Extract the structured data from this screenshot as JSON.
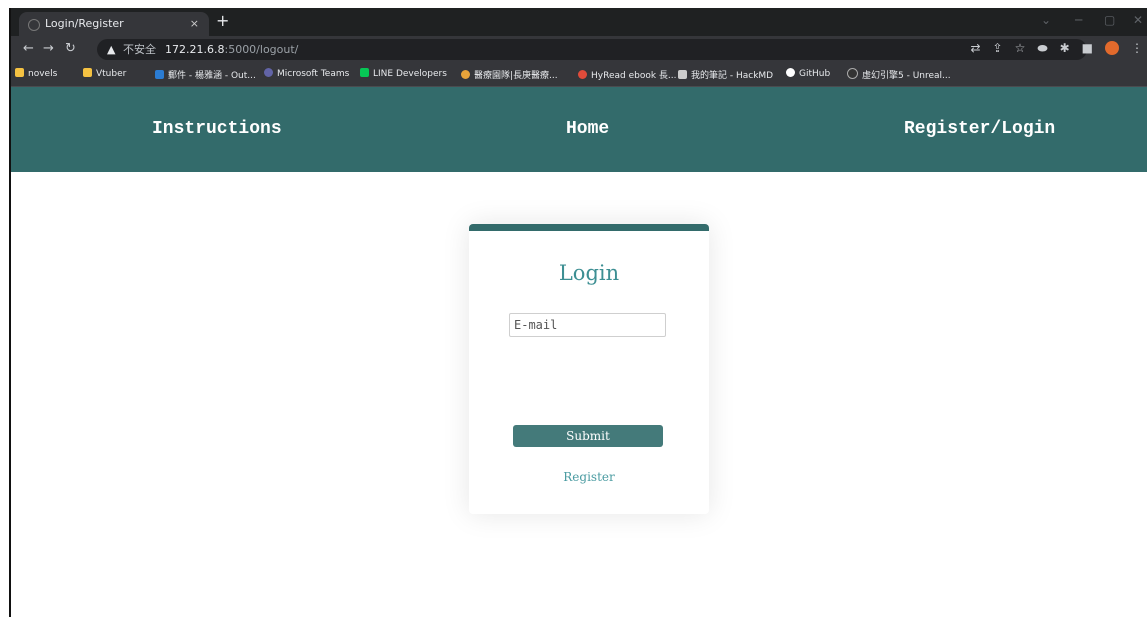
{
  "browser": {
    "tab_title": "Login/Register",
    "tab_close": "×",
    "new_tab": "+",
    "address": {
      "warning": "▲",
      "security_label": "不安全",
      "host": "172.21.6.8",
      "path": ":5000/logout/"
    },
    "bookmarks": [
      {
        "label": "novels",
        "icon_color": "#f5c242"
      },
      {
        "label": "Vtuber",
        "icon_color": "#f5c242"
      },
      {
        "label": "郵件 - 楊雅涵 - Out...",
        "icon_color": "#2b7cd3"
      },
      {
        "label": "Microsoft Teams",
        "icon_color": "#6264a7"
      },
      {
        "label": "LINE Developers",
        "icon_color": "#06c755"
      },
      {
        "label": "醫療園隊|長庚醫療...",
        "icon_color": "#e8a33a"
      },
      {
        "label": "HyRead ebook 長...",
        "icon_color": "#e04b3a"
      },
      {
        "label": "我的筆記 - HackMD",
        "icon_color": "#cccccc"
      },
      {
        "label": "GitHub",
        "icon_color": "#ffffff"
      },
      {
        "label": "虛幻引擎5 - Unreal...",
        "icon_color": "#333333"
      }
    ]
  },
  "site_nav": {
    "instructions": "Instructions",
    "home": "Home",
    "register_login": "Register/Login"
  },
  "login": {
    "title": "Login",
    "email_placeholder": "E-mail",
    "submit_label": "Submit",
    "register_link": "Register"
  },
  "colors": {
    "header": "#336b6b",
    "title_text": "#3d8f93",
    "button": "#447a7a"
  }
}
